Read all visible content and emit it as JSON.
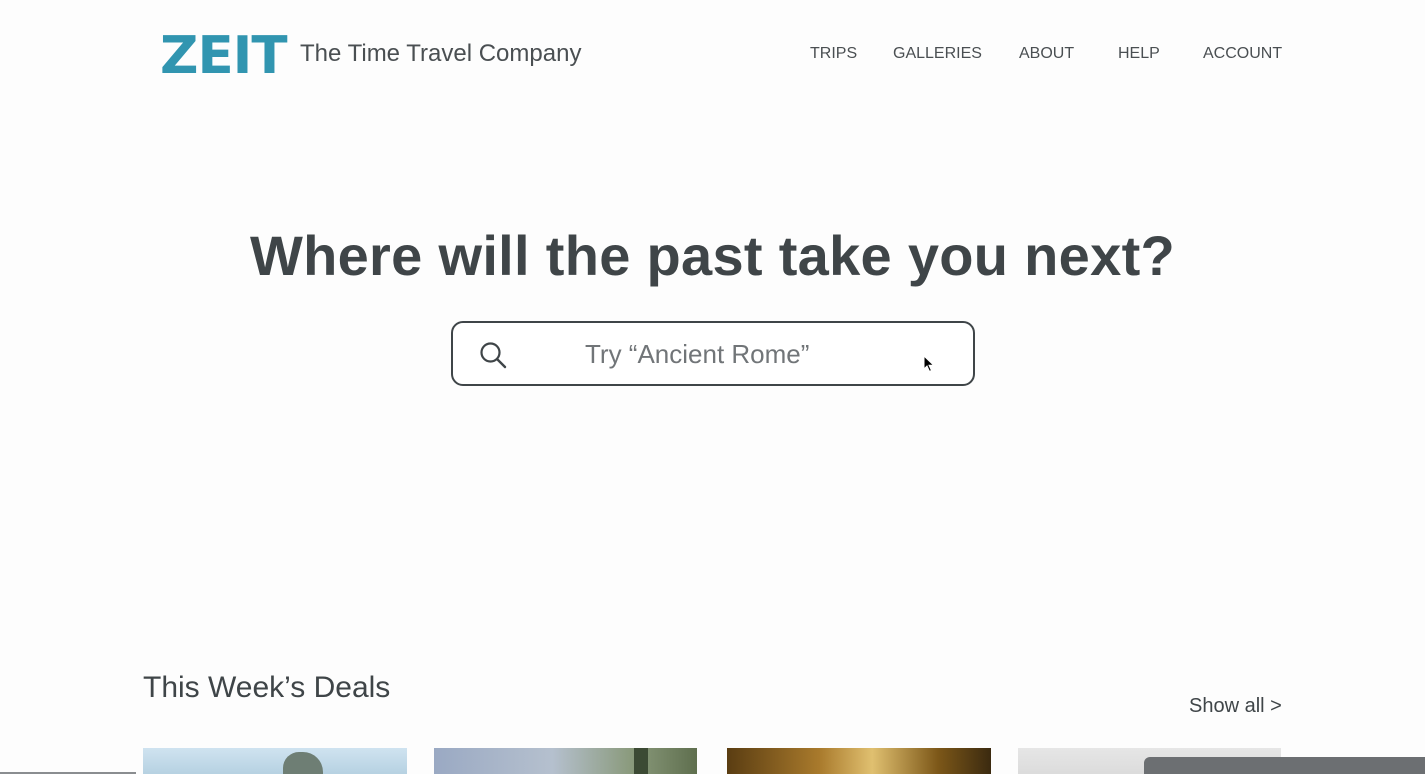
{
  "header": {
    "logo_text": "ZEIT",
    "tagline": "The Time Travel Company",
    "nav": {
      "trips": "TRIPS",
      "galleries": "GALLERIES",
      "about": "ABOUT",
      "help": "HELP",
      "account": "ACCOUNT"
    }
  },
  "hero": {
    "title": "Where will the past take you next?",
    "search": {
      "placeholder": "Try “Ancient Rome”",
      "value": "",
      "icon": "search-icon"
    }
  },
  "deals": {
    "title": "This Week’s Deals",
    "show_all": "Show all >"
  },
  "colors": {
    "brand": "#3195b0",
    "text": "#3f4548",
    "background": "#fdfdfd"
  }
}
